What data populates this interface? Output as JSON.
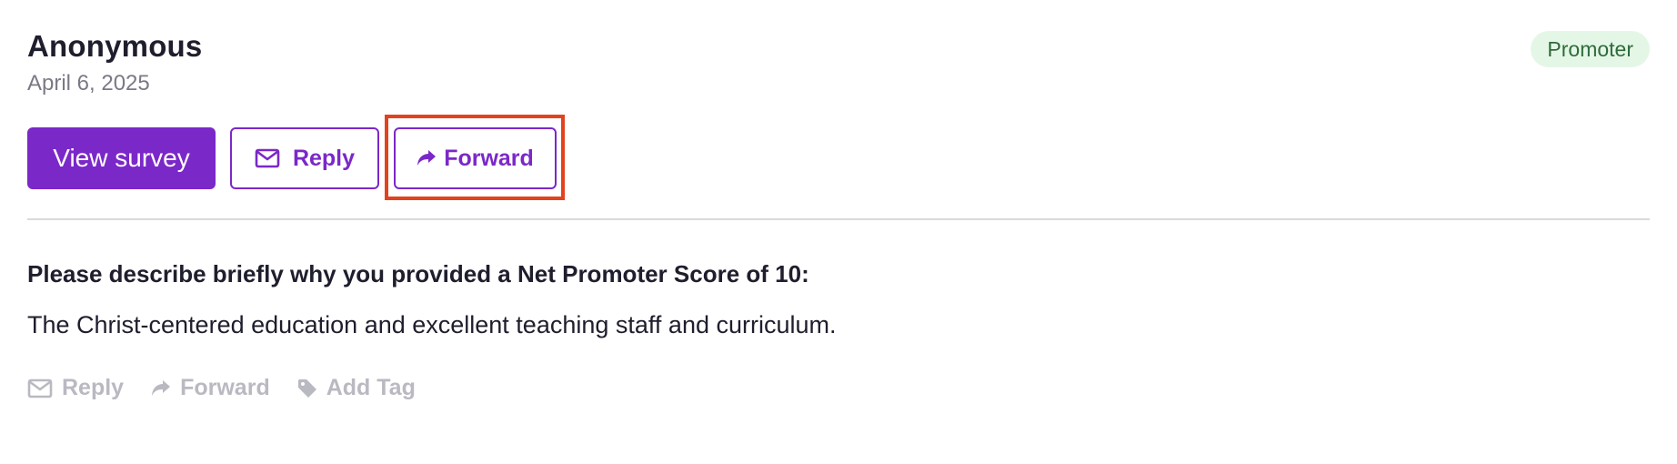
{
  "response": {
    "author": "Anonymous",
    "date": "April 6, 2025",
    "badge": "Promoter"
  },
  "actions": {
    "view_survey": "View survey",
    "reply": "Reply",
    "forward": "Forward"
  },
  "content": {
    "question": "Please describe briefly why you provided a Net Promoter Score of 10:",
    "answer": "The Christ-centered education and excellent teaching staff and curriculum."
  },
  "footer": {
    "reply": "Reply",
    "forward": "Forward",
    "add_tag": "Add Tag"
  },
  "icons": {
    "reply": "envelope-icon",
    "forward": "share-arrow-icon",
    "tag": "tag-icon"
  },
  "colors": {
    "accent": "#7b28c8",
    "badge_bg": "#e4f7e7",
    "badge_text": "#2f6b3a",
    "highlight": "#e2431f",
    "muted": "#b9b9c2"
  }
}
